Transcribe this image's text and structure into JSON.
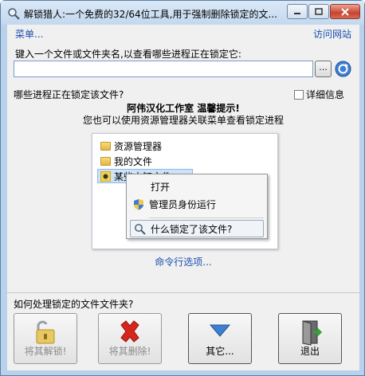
{
  "window": {
    "title": "解锁猎人:一个免费的32/64位工具,用于强制删除锁定的文...",
    "controls": {
      "minimize": "–",
      "maximize": "□",
      "close": "✕"
    }
  },
  "header": {
    "menu_label": "菜单...",
    "site_label": "访问网站"
  },
  "search": {
    "prompt": "键入一个文件或文件夹名,以查看哪些进程正在锁定它:",
    "value": "",
    "browse_label": "..."
  },
  "processes": {
    "label": "哪些进程正在锁定该文件?",
    "details_label": "详细信息",
    "details_checked": false
  },
  "hint": {
    "title": "阿伟汉化工作室 温馨提示!",
    "text": "您也可以使用资源管理器关联菜单查看锁定进程",
    "explorer_items": [
      "资源管理器",
      "我的文件",
      "某些未知文件"
    ],
    "context_menu": [
      "打开",
      "管理员身份运行",
      "什么锁定了该文件?"
    ]
  },
  "cmd_label": "命令行选项...",
  "folder_section_label": "如何处理锁定的文件文件夹?",
  "actions": [
    {
      "label": "将其解锁!",
      "icon": "unlock-icon",
      "enabled": false
    },
    {
      "label": "将其删除!",
      "icon": "delete-icon",
      "enabled": false
    },
    {
      "label": "其它...",
      "icon": "dropdown-arrow-icon",
      "enabled": true
    },
    {
      "label": "退出",
      "icon": "exit-door-icon",
      "enabled": true
    }
  ],
  "colors": {
    "link": "#1b4fb0",
    "titlebar": "#c2d8ef",
    "close_red": "#c8442f"
  }
}
